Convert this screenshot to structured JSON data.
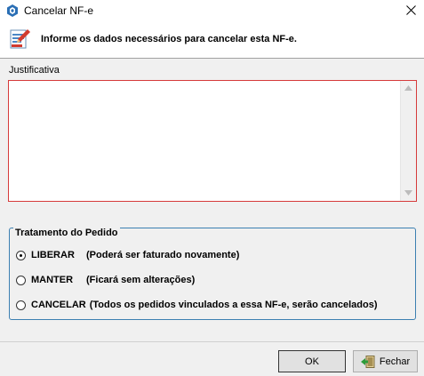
{
  "window": {
    "title": "Cancelar NF-e"
  },
  "header": {
    "text": "Informe os dados necessários para cancelar esta NF-e."
  },
  "justification": {
    "label": "Justificativa",
    "value": ""
  },
  "group": {
    "legend": "Tratamento do Pedido",
    "options": [
      {
        "name": "LIBERAR",
        "desc": "(Poderá ser faturado novamente)",
        "selected": true
      },
      {
        "name": "MANTER",
        "desc": "(Ficará sem alterações)",
        "selected": false
      },
      {
        "name": "CANCELAR",
        "desc": "(Todos os pedidos vinculados a essa NF-e, serão cancelados)",
        "selected": false
      }
    ]
  },
  "buttons": {
    "ok": "OK",
    "close": "Fechar"
  },
  "colors": {
    "accent_border": "#d63a3a",
    "group_border": "#3c7fb1"
  }
}
